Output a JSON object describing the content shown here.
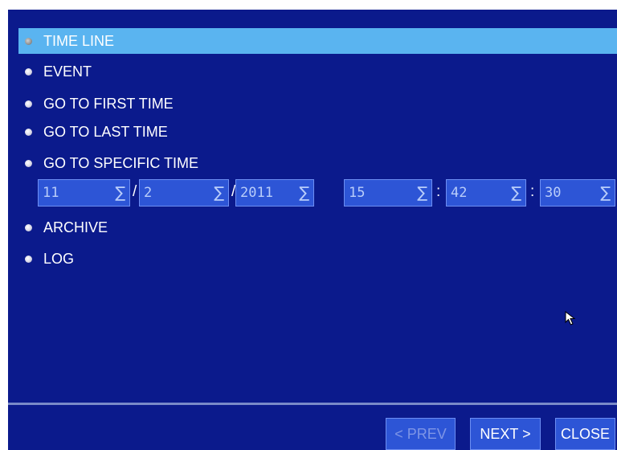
{
  "menu": {
    "items": [
      {
        "label": "TIME LINE",
        "selected": true
      },
      {
        "label": "EVENT",
        "selected": false
      },
      {
        "label": "GO TO FIRST TIME",
        "selected": false
      },
      {
        "label": "GO TO LAST TIME",
        "selected": false
      },
      {
        "label": "GO TO SPECIFIC TIME",
        "selected": false
      },
      {
        "label": "ARCHIVE",
        "selected": false
      },
      {
        "label": "LOG",
        "selected": false
      }
    ]
  },
  "specific_time": {
    "month": "11",
    "day": "2",
    "year": "2011",
    "hour": "15",
    "minute": "42",
    "second": "30",
    "date_separator": "/",
    "time_separator": ":",
    "spin_icon": "sigma-dropdown-icon",
    "spin_glyph": "∑"
  },
  "buttons": {
    "prev": {
      "label": "< PREV",
      "enabled": false
    },
    "next": {
      "label": "NEXT >",
      "enabled": true
    },
    "close": {
      "label": "CLOSE",
      "enabled": true
    }
  },
  "colors": {
    "background": "#0b1a8c",
    "highlight": "#5ab4f0",
    "field": "#2d55d6"
  }
}
